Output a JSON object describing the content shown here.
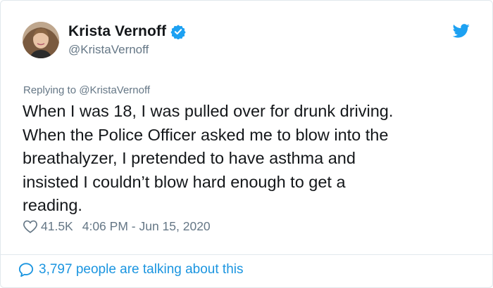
{
  "author": {
    "display_name": "Krista Vernoff",
    "handle": "@KristaVernoff",
    "avatar_icon": "profile-photo",
    "verified_icon": "verified-badge-icon"
  },
  "tweet": {
    "replying_to": "Replying to @KristaVernoff",
    "text": "When I was 18, I was pulled over for drunk driving.\nWhen the Police Officer asked me to blow into the\nbreathalyzer, I pretended to have asthma and\ninsisted I couldn’t blow hard enough to get a\nreading.",
    "likes": "41.5K",
    "timestamp": "4:06 PM - Jun 15, 2020"
  },
  "footer": {
    "conversation_label": "3,797 people are talking about this"
  },
  "colors": {
    "twitter_blue": "#1da1f2",
    "link_blue": "#1b95e0",
    "secondary_text": "#657786",
    "border": "#e1e8ed"
  }
}
